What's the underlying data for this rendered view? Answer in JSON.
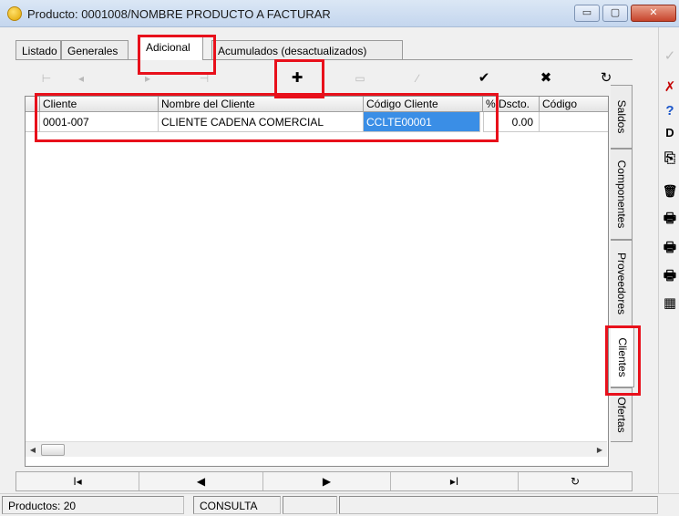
{
  "window": {
    "title": "Producto: 0001008/NOMBRE PRODUCTO A FACTURAR",
    "min": "▭",
    "max": "▢",
    "close": "✕"
  },
  "tabs": [
    "Listado",
    "Generales",
    "Adicional",
    "Acumulados (desactualizados)"
  ],
  "toolbar": {
    "first": "⊢",
    "prev": "◂",
    "next": "▸",
    "last": "⊣",
    "add": "✚",
    "edit": "▭",
    "pencil": "∕",
    "save": "✔",
    "cancel": "✖",
    "refresh": "↻"
  },
  "grid": {
    "columns": [
      "Cliente",
      "Nombre del Cliente",
      "Código Cliente",
      "% Dscto.",
      "Código"
    ],
    "rows": [
      {
        "cliente": "0001-007",
        "nombre": "CLIENTE CADENA COMERCIAL",
        "codigo_cliente": "CCLTE00001",
        "dscto": "0.00",
        "codigo": ""
      }
    ]
  },
  "side_tabs": [
    "Saldos",
    "Componentes",
    "Proveedores",
    "Clientes",
    "Ofertas"
  ],
  "nav": {
    "first": "I◂",
    "prev": "◀",
    "next": "▶",
    "last": "▸I",
    "refresh": "↻"
  },
  "status": {
    "productos": "Productos: 20",
    "mode": "CONSULTA"
  },
  "right_toolbar": {
    "ok": "✓",
    "delete": "✗",
    "help": "?",
    "new": "D",
    "copy": "⎘",
    "trash": "🗑",
    "print1": "🖶",
    "print2": "🖶",
    "print3": "🖶",
    "calc": "▦"
  },
  "colors": {
    "highlight": "#e8101b",
    "selection": "#3a8ee6",
    "danger": "#c40000",
    "help": "#1a55c9"
  }
}
